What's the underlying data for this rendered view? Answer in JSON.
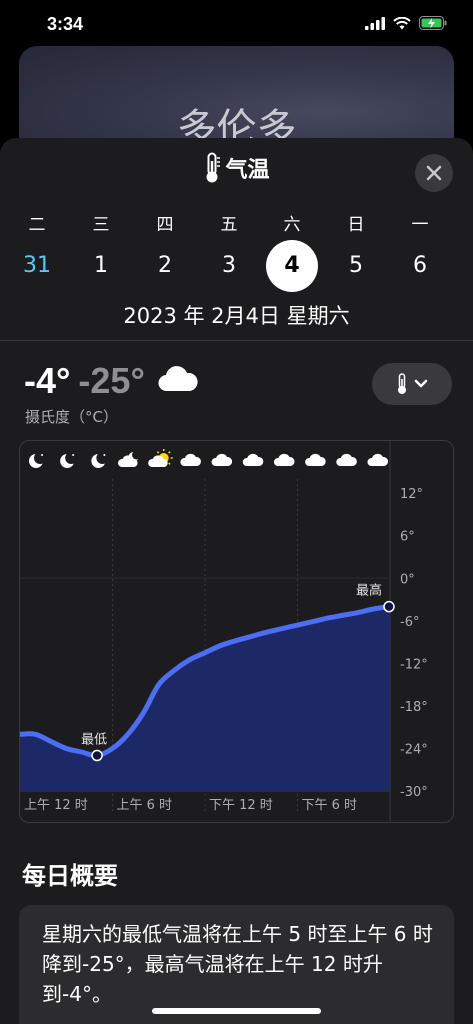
{
  "status": {
    "time": "3:34"
  },
  "background": {
    "city": "多伦多"
  },
  "sheet": {
    "title": "气温",
    "weekdays": [
      "二",
      "三",
      "四",
      "五",
      "六",
      "日",
      "一"
    ],
    "dates": [
      "31",
      "1",
      "2",
      "3",
      "4",
      "5",
      "6"
    ],
    "selected_index": 4,
    "full_date": "2023 年 2月4日 星期六"
  },
  "conditions": {
    "high": "-4°",
    "low": "-25°",
    "unit_label": "摄氏度（°C）"
  },
  "chart_data": {
    "type": "area",
    "x_ticks": [
      "上午 12 时",
      "上午 6 时",
      "下午 12 时",
      "下午 6 时"
    ],
    "y_ticks": [
      "12°",
      "6°",
      "0°",
      "-6°",
      "-12°",
      "-18°",
      "-24°",
      "-30°"
    ],
    "ylim": [
      -30,
      14
    ],
    "x_hours": [
      0,
      1,
      2,
      3,
      4,
      5,
      6,
      7,
      8,
      9,
      10,
      11,
      12,
      13,
      14,
      15,
      16,
      17,
      18,
      19,
      20,
      21,
      22,
      23,
      24
    ],
    "temps": [
      -22,
      -22,
      -23,
      -24,
      -24.5,
      -25,
      -24,
      -22,
      -19,
      -15,
      -13,
      -11.5,
      -10.5,
      -9.5,
      -8.8,
      -8.2,
      -7.6,
      -7.1,
      -6.6,
      -6.1,
      -5.6,
      -5.2,
      -4.8,
      -4.3,
      -4
    ],
    "low_label": "最低",
    "high_label": "最高",
    "low_hour": 5,
    "high_hour": 24,
    "weather_icons": [
      "moon",
      "moon",
      "moon",
      "moon-cloud",
      "sun-cloud",
      "cloud",
      "cloud",
      "cloud",
      "cloud",
      "cloud",
      "cloud",
      "cloud"
    ],
    "colors": {
      "line": "#4c6ef5",
      "fill": "#1e2a6e",
      "grid": "#3a3a3c",
      "sun": "#ffd60a"
    }
  },
  "summary": {
    "title": "每日概要",
    "text": "星期六的最低气温将在上午 5 时至上午 6 时降到-25°，最高气温将在上午 12 时升到-4°。"
  }
}
